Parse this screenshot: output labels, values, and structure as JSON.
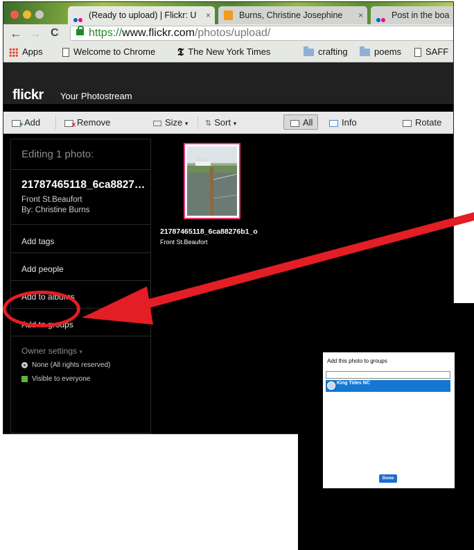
{
  "browser": {
    "tabs": [
      {
        "label": "(Ready to upload) | Flickr: U",
        "active": true
      },
      {
        "label": "Burns, Christine Josephine",
        "active": false
      },
      {
        "label": "Post in the boa",
        "active": false
      }
    ],
    "tab_close_glyph": "×",
    "url_scheme": "https://",
    "url_host": "www.flickr.com",
    "url_path": "/photos/upload/",
    "nav": {
      "back": "←",
      "forward": "→",
      "reload": "C"
    },
    "bookmarks": [
      {
        "label": "Apps",
        "icon": "apps-grid-icon"
      },
      {
        "label": "Welcome to Chrome",
        "icon": "page-icon"
      },
      {
        "label": "The New York Times",
        "icon": "nyt-icon"
      },
      {
        "label": "crafting",
        "icon": "folder-icon"
      },
      {
        "label": "poems",
        "icon": "folder-icon"
      },
      {
        "label": "SAFF",
        "icon": "page-icon"
      }
    ],
    "nyt_glyph": "𝕿"
  },
  "flickr": {
    "logo": "flickr",
    "nav_photostream": "Your Photostream"
  },
  "toolbar": {
    "add": "Add",
    "remove": "Remove",
    "size": "Size",
    "sort": "Sort",
    "caret": "▾",
    "sort_glyph": "⇅",
    "all": "All",
    "info": "Info",
    "rotate": "Rotate"
  },
  "sidebar": {
    "editing_label": "Editing 1 photo:",
    "photo_name": "21787465118_6ca8827…",
    "photo_title": "Front St.Beaufort",
    "photo_by": "By: Christine Burns",
    "add_tags": "Add tags",
    "add_people": "Add people",
    "add_albums": "Add to albums",
    "add_groups": "Add to groups",
    "owner_settings": "Owner settings",
    "owner_caret": "▾",
    "license": "None (All rights reserved)",
    "visibility": "Visible to everyone"
  },
  "thumbnail": {
    "name": "21787465118_6ca88276b1_o",
    "title": "Front St.Beaufort"
  },
  "group_dialog": {
    "title": "Add this photo to groups",
    "search_value": "",
    "groups": [
      {
        "name": "King Tides NC",
        "selected": true
      }
    ],
    "done_label": "Done"
  },
  "annotation": {
    "color": "#e31e24",
    "highlight": "add-to-groups"
  },
  "colors": {
    "flickr_pink": "#e8317a",
    "flickr_blue": "#1677d2",
    "https_green": "#1e8a27"
  }
}
